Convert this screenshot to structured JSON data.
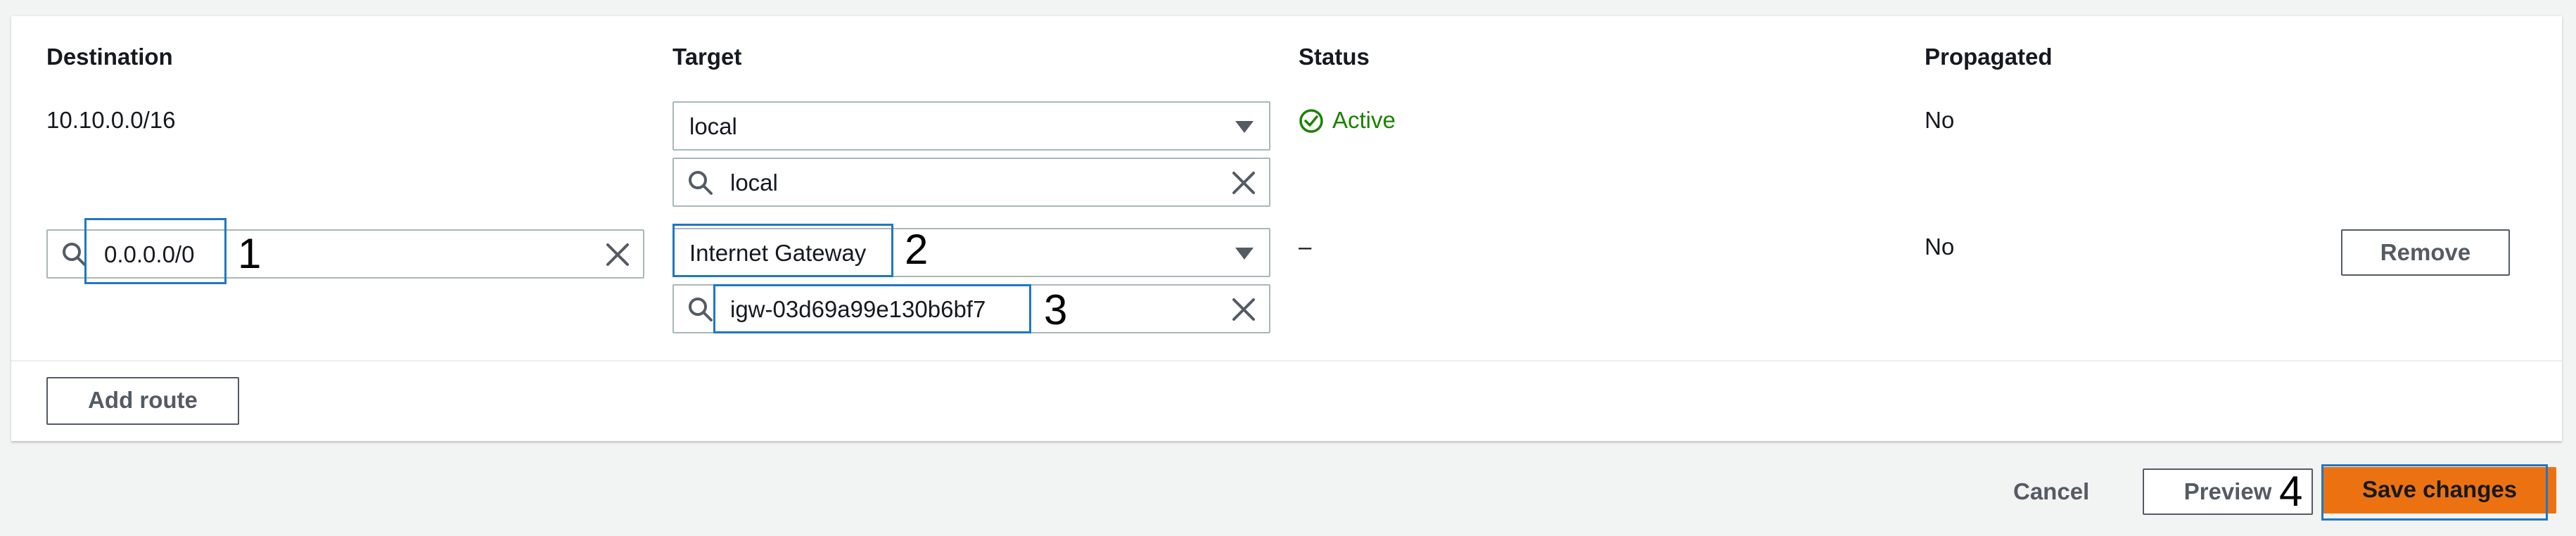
{
  "table": {
    "headers": {
      "destination": "Destination",
      "target": "Target",
      "status": "Status",
      "propagated": "Propagated"
    },
    "rows": [
      {
        "destination": "10.10.0.0/16",
        "target_select": "local",
        "target_search": "local",
        "status": "Active",
        "propagated": "No"
      },
      {
        "destination_search": "0.0.0.0/0",
        "target_select": "Internet Gateway",
        "target_search": "igw-03d69a99e130b6bf7",
        "status": "–",
        "propagated": "No",
        "remove_label": "Remove"
      }
    ]
  },
  "add_route_label": "Add route",
  "footer": {
    "cancel_label": "Cancel",
    "preview_label": "Preview",
    "save_label": "Save changes"
  },
  "annotations": [
    "1",
    "2",
    "3",
    "4"
  ],
  "colors": {
    "active_status": "#1d8102",
    "primary": "#ec7211",
    "highlight": "#1f77c4"
  },
  "icons": {
    "status": "check-circle-icon",
    "search": "search-icon",
    "clear": "clear-icon",
    "dropdown": "caret-down-icon"
  }
}
